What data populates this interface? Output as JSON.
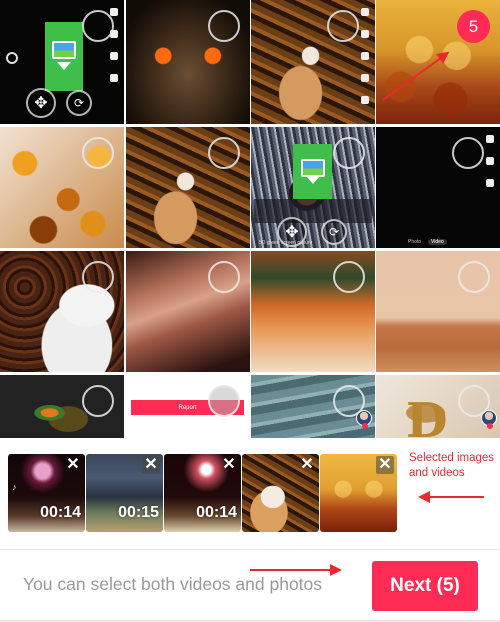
{
  "gallery": {
    "tiles": [
      {
        "kind": "tiktok-green-screen-effect",
        "selected": false
      },
      {
        "kind": "owl-closeup",
        "selected": false
      },
      {
        "kind": "cat-in-leaves-video",
        "selected": false
      },
      {
        "kind": "amber-bubbles",
        "selected": true,
        "order": "5"
      },
      {
        "kind": "amber-gems",
        "selected": false
      },
      {
        "kind": "cat-in-leaves",
        "selected": false
      },
      {
        "kind": "green-screen-owl-eye",
        "selected": false
      },
      {
        "kind": "black-camera-screen",
        "selected": false,
        "tabs": [
          "Photo",
          "Video"
        ]
      },
      {
        "kind": "coffee-cup",
        "selected": false
      },
      {
        "kind": "antelope-canyon",
        "selected": false
      },
      {
        "kind": "red-rock-hoodoos",
        "selected": false
      },
      {
        "kind": "desert-dunes",
        "selected": false
      },
      {
        "kind": "wok-stir-fry",
        "selected": false
      },
      {
        "kind": "report-screen",
        "selected": false,
        "button_label": "Report"
      },
      {
        "kind": "airport-planes",
        "selected": false
      },
      {
        "kind": "golden-crown-letter",
        "selected": false
      }
    ],
    "green_screen_search": "5D green screen picture"
  },
  "selected_strip": {
    "items": [
      {
        "kind": "fireworks-video",
        "duration": "00:14",
        "remove_icon": "close-icon"
      },
      {
        "kind": "city-night-video",
        "duration": "00:15",
        "remove_icon": "close-icon"
      },
      {
        "kind": "fireworks-video-2",
        "duration": "00:14",
        "remove_icon": "close-icon"
      },
      {
        "kind": "cat-photo",
        "duration": null,
        "remove_icon": "close-icon"
      },
      {
        "kind": "bubbles-photo",
        "duration": null,
        "remove_icon": "close-icon"
      }
    ],
    "close_glyph": "✕"
  },
  "annotations": {
    "selected_label_line1": "Selected images",
    "selected_label_line2": "and videos",
    "color": "#e9292c"
  },
  "footer": {
    "hint": "You can select both videos and photos",
    "next_label": "Next (5)",
    "next_color": "#fe2c55"
  }
}
